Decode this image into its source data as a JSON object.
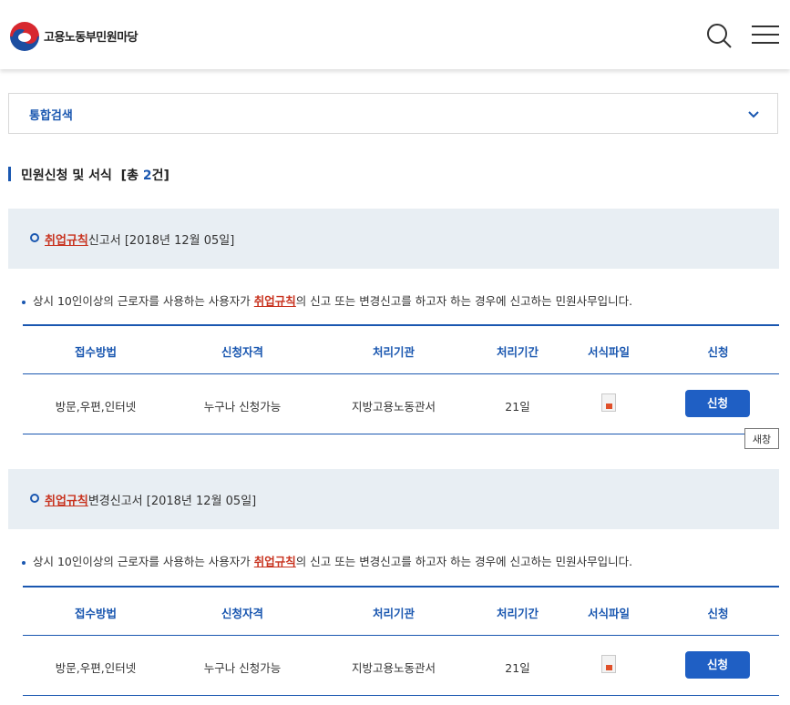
{
  "header": {
    "brand": "고용노동부민원마당"
  },
  "search": {
    "label": "통합검색"
  },
  "section": {
    "title": "민원신청 및 서식",
    "count_prefix": "[총 ",
    "count": "2",
    "count_suffix": "건]"
  },
  "columns": [
    "접수방법",
    "신청자격",
    "처리기관",
    "처리기간",
    "서식파일",
    "신청"
  ],
  "items": [
    {
      "keyword": "취업규칙",
      "title_rest": "신고서 [2018년 12월 05일]",
      "desc_pre": "상시 10인이상의 근로자를 사용하는 사용자가 ",
      "desc_keyword": "취업규칙",
      "desc_post": "의 신고 또는 변경신고를 하고자 하는 경우에 신고하는 민원사무입니다.",
      "method": "방문,우편,인터넷",
      "eligibility": "누구나 신청가능",
      "agency": "지방고용노동관서",
      "period": "21일",
      "button": "신청"
    },
    {
      "keyword": "취업규칙",
      "title_rest": "변경신고서 [2018년 12월 05일]",
      "desc_pre": "상시 10인이상의 근로자를 사용하는 사용자가 ",
      "desc_keyword": "취업규칙",
      "desc_post": "의 신고 또는 변경신고를 하고자 하는 경우에 신고하는 민원사무입니다.",
      "method": "방문,우편,인터넷",
      "eligibility": "누구나 신청가능",
      "agency": "지방고용노동관서",
      "period": "21일",
      "button": "신청"
    }
  ],
  "tooltip": "새창",
  "icons": {
    "search": "search-icon",
    "menu": "hamburger-menu-icon",
    "chevron": "chevron-down-icon",
    "file": "hwp-file-icon"
  },
  "colors": {
    "accent": "#1a57b0",
    "button": "#1f5fc4",
    "highlight": "#c8331f",
    "item_bg": "#e8eef3"
  }
}
